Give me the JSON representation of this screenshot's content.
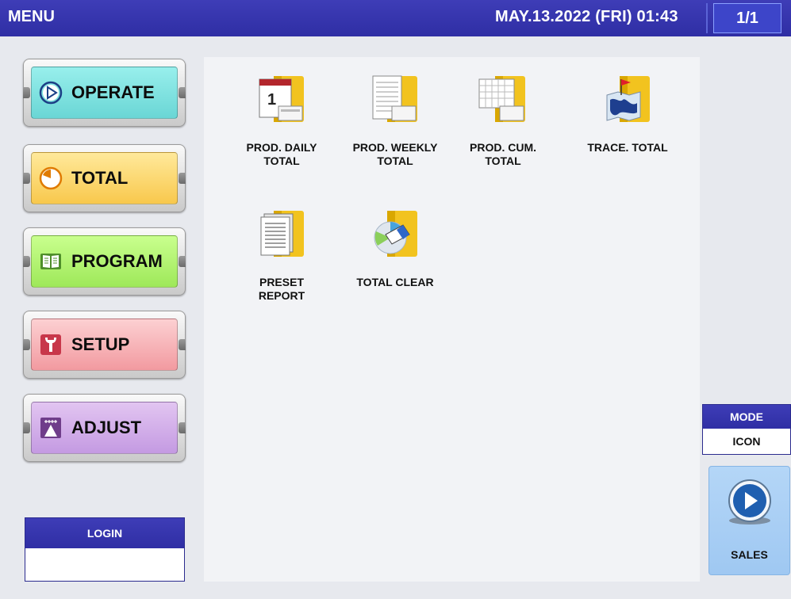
{
  "header": {
    "title": "MENU",
    "datetime": "MAY.13.2022 (FRI)  01:43",
    "page": "1/1"
  },
  "menu": {
    "items": [
      {
        "label": "OPERATE",
        "icon": "play-circle-icon"
      },
      {
        "label": "TOTAL",
        "icon": "pie-timer-icon"
      },
      {
        "label": "PROGRAM",
        "icon": "open-book-icon"
      },
      {
        "label": "SETUP",
        "icon": "wrench-icon"
      },
      {
        "label": "ADJUST",
        "icon": "scale-gauge-icon"
      }
    ]
  },
  "login": {
    "label": "LOGIN"
  },
  "tiles": [
    {
      "label": "PROD. DAILY\nTOTAL",
      "icon": "daily-calendar-icon"
    },
    {
      "label": "PROD. WEEKLY\nTOTAL",
      "icon": "weekly-calendar-icon"
    },
    {
      "label": "PROD. CUM.\nTOTAL",
      "icon": "cumulative-calendar-icon"
    },
    {
      "label": "TRACE. TOTAL",
      "icon": "trace-map-icon"
    },
    {
      "label": "PRESET\nREPORT",
      "icon": "report-document-icon"
    },
    {
      "label": "TOTAL CLEAR",
      "icon": "eraser-clear-icon"
    }
  ],
  "mode": {
    "label": "MODE",
    "value": "ICON"
  },
  "sales": {
    "label": "SALES",
    "icon": "play-circle-icon"
  },
  "colors": {
    "header_blue": "#3432ad",
    "operate": "#7fe2e1",
    "total": "#fbd66a",
    "program": "#b4f378",
    "setup": "#f6b2b6",
    "adjust": "#d4b0ea",
    "sales_bg": "#a9d0f5",
    "tile_gold": "#f2c31f"
  }
}
